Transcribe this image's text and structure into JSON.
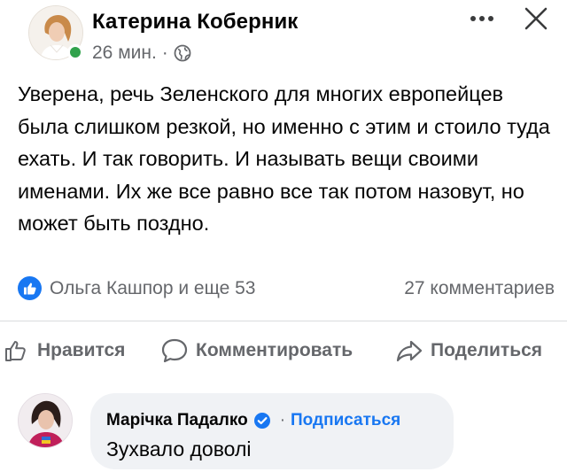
{
  "post": {
    "author": "Катерина Коберник",
    "time": "26 мин.",
    "separator": "·",
    "privacy_icon": "globe-icon",
    "text": "Уверена, речь Зеленского для многих европейцев была слишком резкой, но именно с этим и стоило туда ехать. И так говорить. И называть вещи своими именами. Их же все равно все так потом назовут, но может быть поздно."
  },
  "reactions": {
    "icon": "like-icon",
    "summary": "Ольга Кашпор и еще 53",
    "comments": "27 комментариев"
  },
  "actions": {
    "like": "Нравится",
    "comment": "Комментировать",
    "share": "Поделиться"
  },
  "comment": {
    "author": "Марічка Падалко",
    "verified_icon": "verified-icon",
    "separator": "·",
    "follow": "Подписаться",
    "text": "Зухвало доволі"
  },
  "colors": {
    "accent": "#1877f2",
    "secondary_text": "#65676b",
    "online": "#31a24c",
    "bubble": "#f0f2f5"
  }
}
